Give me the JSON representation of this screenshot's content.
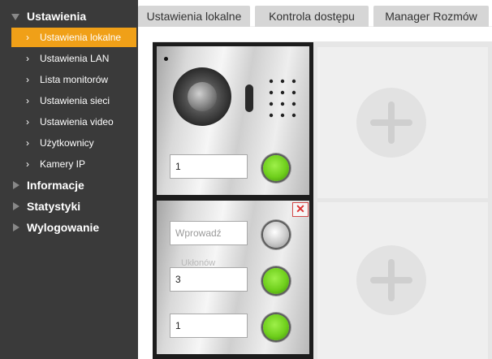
{
  "sidebar": {
    "sections": [
      {
        "label": "Ustawienia",
        "expanded": true
      },
      {
        "label": "Informacje",
        "expanded": false
      },
      {
        "label": "Statystyki",
        "expanded": false
      },
      {
        "label": "Wylogowanie",
        "expanded": false
      }
    ],
    "items": [
      {
        "label": "Ustawienia lokalne",
        "active": true
      },
      {
        "label": "Ustawienia LAN"
      },
      {
        "label": "Lista monitorów"
      },
      {
        "label": "Ustawienia sieci"
      },
      {
        "label": "Ustawienia video"
      },
      {
        "label": "Użytkownicy"
      },
      {
        "label": "Kamery IP"
      }
    ],
    "active_color": "#f0a018"
  },
  "tabs": [
    {
      "label": "Ustawienia lokalne"
    },
    {
      "label": "Kontrola dostępu"
    },
    {
      "label": "Manager Rozmów"
    }
  ],
  "panel": {
    "camera_module": {
      "field_value": "1"
    },
    "button_module": {
      "field1_placeholder": "Wprowadź",
      "field1_value": "",
      "ghost_label": "Ukłonów",
      "field2_value": "3",
      "field3_value": "1",
      "close_label": "✕"
    }
  },
  "icons": {
    "chevron": "›",
    "plus": "add-slot-icon"
  }
}
